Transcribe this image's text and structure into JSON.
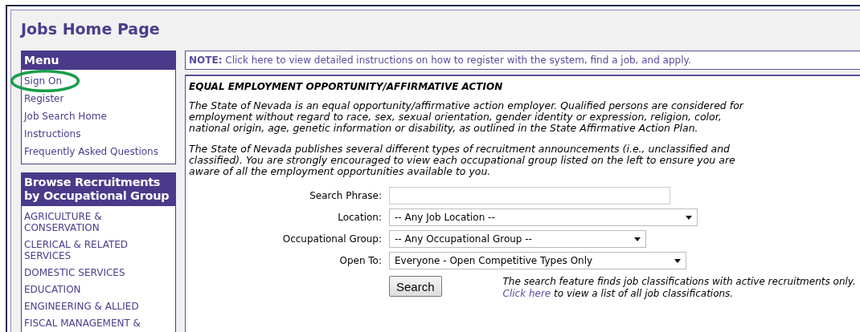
{
  "page": {
    "title": "Jobs Home Page"
  },
  "menu": {
    "title": "Menu",
    "items": [
      {
        "label": "Sign On",
        "circled": true
      },
      {
        "label": "Register",
        "circled": false
      },
      {
        "label": "Job Search Home",
        "circled": false
      },
      {
        "label": "Instructions",
        "circled": false
      },
      {
        "label": "Frequently Asked Questions",
        "circled": false
      }
    ]
  },
  "browse": {
    "title": "Browse Recruitments by Occupational Group",
    "items": [
      "AGRICULTURE & CONSERVATION",
      "CLERICAL & RELATED SERVICES",
      "DOMESTIC SERVICES",
      "EDUCATION",
      "ENGINEERING & ALLIED",
      "FISCAL MANAGEMENT &"
    ]
  },
  "note": {
    "label": "NOTE:",
    "text": "Click here to view detailed instructions on how to register with the system, find a job, and apply."
  },
  "notice": {
    "heading": "EQUAL EMPLOYMENT OPPORTUNITY/AFFIRMATIVE ACTION",
    "paragraphs": [
      "The State of Nevada is an equal opportunity/affirmative action employer. Qualified persons are considered for employment without regard to race, sex, sexual orientation, gender identity or expression, religion, color, national origin, age, genetic information or disability, as outlined in the State Affirmative Action Plan.",
      "The State of Nevada publishes several different types of recruitment announcements (i.e., unclassified and classified). You are strongly encouraged to view each occupational group listed on the left to ensure you are aware of all the employment opportunities available to you."
    ]
  },
  "search_form": {
    "fields": [
      {
        "kind": "text",
        "label": "Search Phrase:"
      },
      {
        "kind": "select",
        "label": "Location:",
        "value": "-- Any Job Location --"
      },
      {
        "kind": "select",
        "label": "Occupational Group:",
        "value": "-- Any Occupational Group --"
      },
      {
        "kind": "select",
        "label": "Open To:",
        "value": "Everyone - Open Competitive Types Only"
      }
    ],
    "button": "Search",
    "hint": {
      "before": "The search feature finds job classifications with active recruitments only.",
      "link": "Click here",
      "after": "to view a list of all job classifications."
    }
  }
}
